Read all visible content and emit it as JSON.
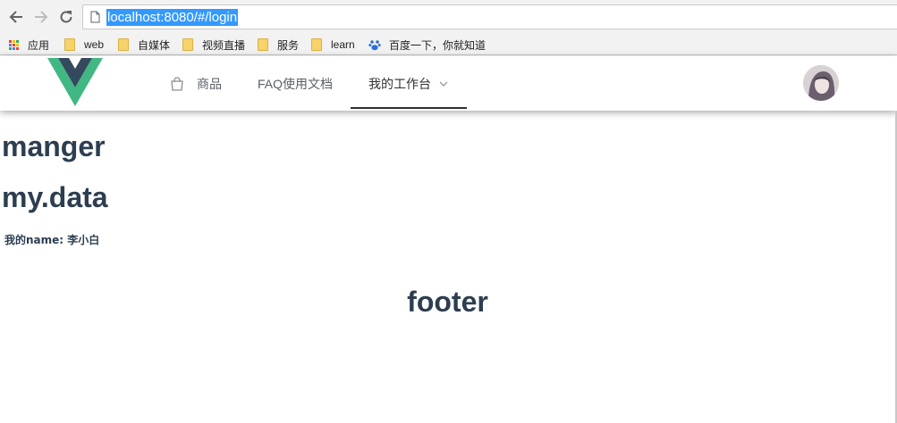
{
  "browser": {
    "url": "localhost:8080/#/login",
    "back_icon": "back-arrow-icon",
    "forward_icon": "forward-arrow-icon",
    "reload_icon": "reload-icon",
    "page_icon": "page-icon"
  },
  "bookmarks": [
    {
      "label": "应用",
      "icon": "apps-grid-icon"
    },
    {
      "label": "web",
      "icon": "folder-icon"
    },
    {
      "label": "自媒体",
      "icon": "folder-icon"
    },
    {
      "label": "视频直播",
      "icon": "folder-icon"
    },
    {
      "label": "服务",
      "icon": "folder-icon"
    },
    {
      "label": "learn",
      "icon": "folder-icon"
    },
    {
      "label": "百度一下，你就知道",
      "icon": "baidu-paw-icon"
    }
  ],
  "header": {
    "logo": "vue-logo",
    "menu": [
      {
        "label": "商品",
        "icon": "shopping-bag-icon"
      },
      {
        "label": "FAQ使用文档"
      },
      {
        "label": "我的工作台",
        "icon": "chevron-down-icon",
        "active": true
      }
    ],
    "avatar": "user-avatar"
  },
  "content": {
    "heading1": "manger",
    "heading2": "my.data",
    "name_line": "我的name: 李小白",
    "footer": "footer"
  },
  "colors": {
    "text": "#2c3e50",
    "vue_green": "#41b883",
    "vue_dark": "#34495e",
    "url_highlight": "#3399ff"
  }
}
